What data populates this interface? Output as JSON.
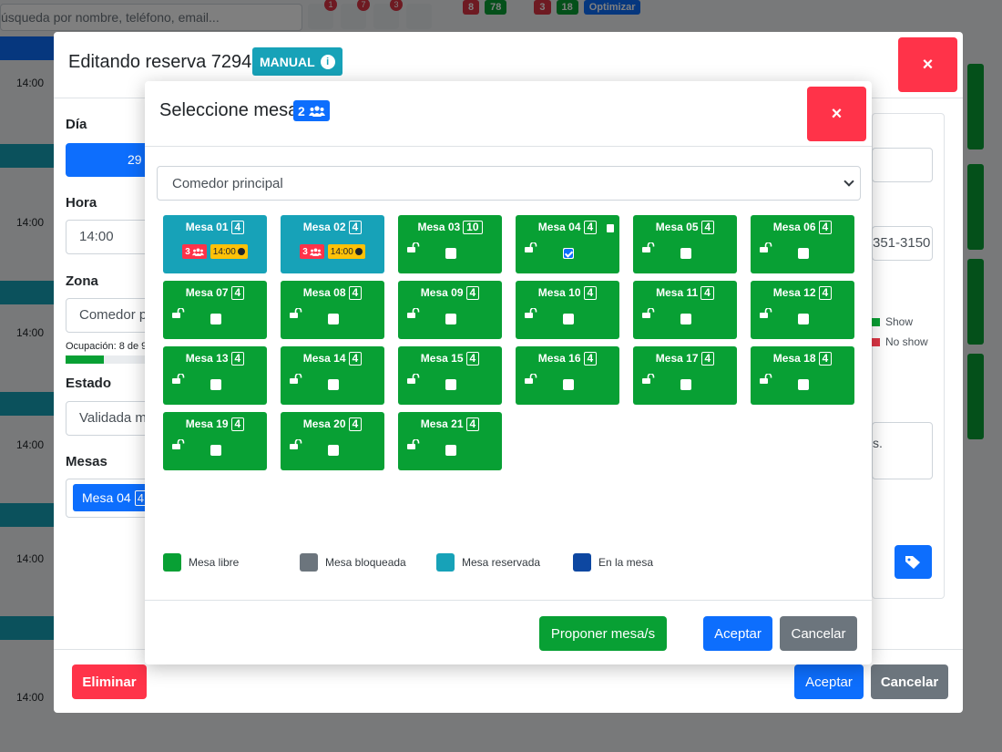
{
  "background": {
    "search_placeholder": "úsqueda por nombre, teléfono, email...",
    "top_badges": [
      "1",
      "7",
      "3"
    ],
    "right_pills": [
      {
        "text": "8",
        "color": "#dc3545"
      },
      {
        "text": "78",
        "color": "#08a034"
      },
      {
        "text": "3",
        "color": "#dc3545"
      },
      {
        "text": "18",
        "color": "#08a034"
      },
      {
        "text": "Optimizar",
        "color": "#0d6efd"
      }
    ],
    "times": [
      "14:00",
      "14:00",
      "14:00",
      "14:00",
      "14:00",
      "14:00",
      "14:00",
      "14:00"
    ]
  },
  "outer_modal": {
    "title": "Editando reserva 72949",
    "badge": "MANUAL",
    "close_symbol": "×",
    "fields": {
      "dia_label": "Día",
      "dia_value": "29",
      "hora_label": "Hora",
      "hora_value": "14:00",
      "zona_label": "Zona",
      "zona_value": "Comedor p",
      "ocupacion_text": "Ocupación: 8 de 9",
      "ocupacion_fraction": 0.42,
      "estado_label": "Estado",
      "estado_value": "Validada m",
      "mesas_label": "Mesas",
      "mesas_chip": "Mesa 04",
      "mesas_chip_cap": "4"
    },
    "right": {
      "phone_partial": "351-3150",
      "show_label": "Show",
      "noshow_label": "No show",
      "show_color": "#08a034",
      "noshow_color": "#dc3545",
      "notes_partial": "s."
    },
    "footer": {
      "delete_label": "Eliminar",
      "accept_label": "Aceptar",
      "cancel_label": "Cancelar"
    }
  },
  "inner_modal": {
    "title": "Seleccione mesa",
    "guest_count": "2",
    "close_symbol": "×",
    "zone_select_value": "Comedor principal",
    "tables": [
      {
        "name": "Mesa 01",
        "cap": "4",
        "status": "reserved",
        "guests": "3",
        "time": "14:00"
      },
      {
        "name": "Mesa 02",
        "cap": "4",
        "status": "reserved",
        "guests": "3",
        "time": "14:00"
      },
      {
        "name": "Mesa 03",
        "cap": "10",
        "status": "free",
        "checked": false
      },
      {
        "name": "Mesa 04",
        "cap": "4",
        "status": "free",
        "checked": true,
        "note": true
      },
      {
        "name": "Mesa 05",
        "cap": "4",
        "status": "free",
        "checked": false
      },
      {
        "name": "Mesa 06",
        "cap": "4",
        "status": "free",
        "checked": false
      },
      {
        "name": "Mesa 07",
        "cap": "4",
        "status": "free",
        "checked": false
      },
      {
        "name": "Mesa 08",
        "cap": "4",
        "status": "free",
        "checked": false
      },
      {
        "name": "Mesa 09",
        "cap": "4",
        "status": "free",
        "checked": false
      },
      {
        "name": "Mesa 10",
        "cap": "4",
        "status": "free",
        "checked": false
      },
      {
        "name": "Mesa 11",
        "cap": "4",
        "status": "free",
        "checked": false
      },
      {
        "name": "Mesa 12",
        "cap": "4",
        "status": "free",
        "checked": false
      },
      {
        "name": "Mesa 13",
        "cap": "4",
        "status": "free",
        "checked": false
      },
      {
        "name": "Mesa 14",
        "cap": "4",
        "status": "free",
        "checked": false
      },
      {
        "name": "Mesa 15",
        "cap": "4",
        "status": "free",
        "checked": false
      },
      {
        "name": "Mesa 16",
        "cap": "4",
        "status": "free",
        "checked": false
      },
      {
        "name": "Mesa 17",
        "cap": "4",
        "status": "free",
        "checked": false
      },
      {
        "name": "Mesa 18",
        "cap": "4",
        "status": "free",
        "checked": false
      },
      {
        "name": "Mesa 19",
        "cap": "4",
        "status": "free",
        "checked": false
      },
      {
        "name": "Mesa 20",
        "cap": "4",
        "status": "free",
        "checked": false
      },
      {
        "name": "Mesa 21",
        "cap": "4",
        "status": "free",
        "checked": false
      }
    ],
    "legend": [
      {
        "label": "Mesa libre",
        "color": "#08a034"
      },
      {
        "label": "Mesa bloqueada",
        "color": "#6c757d"
      },
      {
        "label": "Mesa reservada",
        "color": "#17a2b8"
      },
      {
        "label": "En la mesa",
        "color": "#0d47a1"
      }
    ],
    "footer": {
      "propose_label": "Proponer mesa/s",
      "accept_label": "Aceptar",
      "cancel_label": "Cancelar"
    },
    "icons": [
      "users-icon",
      "unlock-icon",
      "checkbox-icon",
      "clock-icon",
      "note-icon"
    ]
  }
}
